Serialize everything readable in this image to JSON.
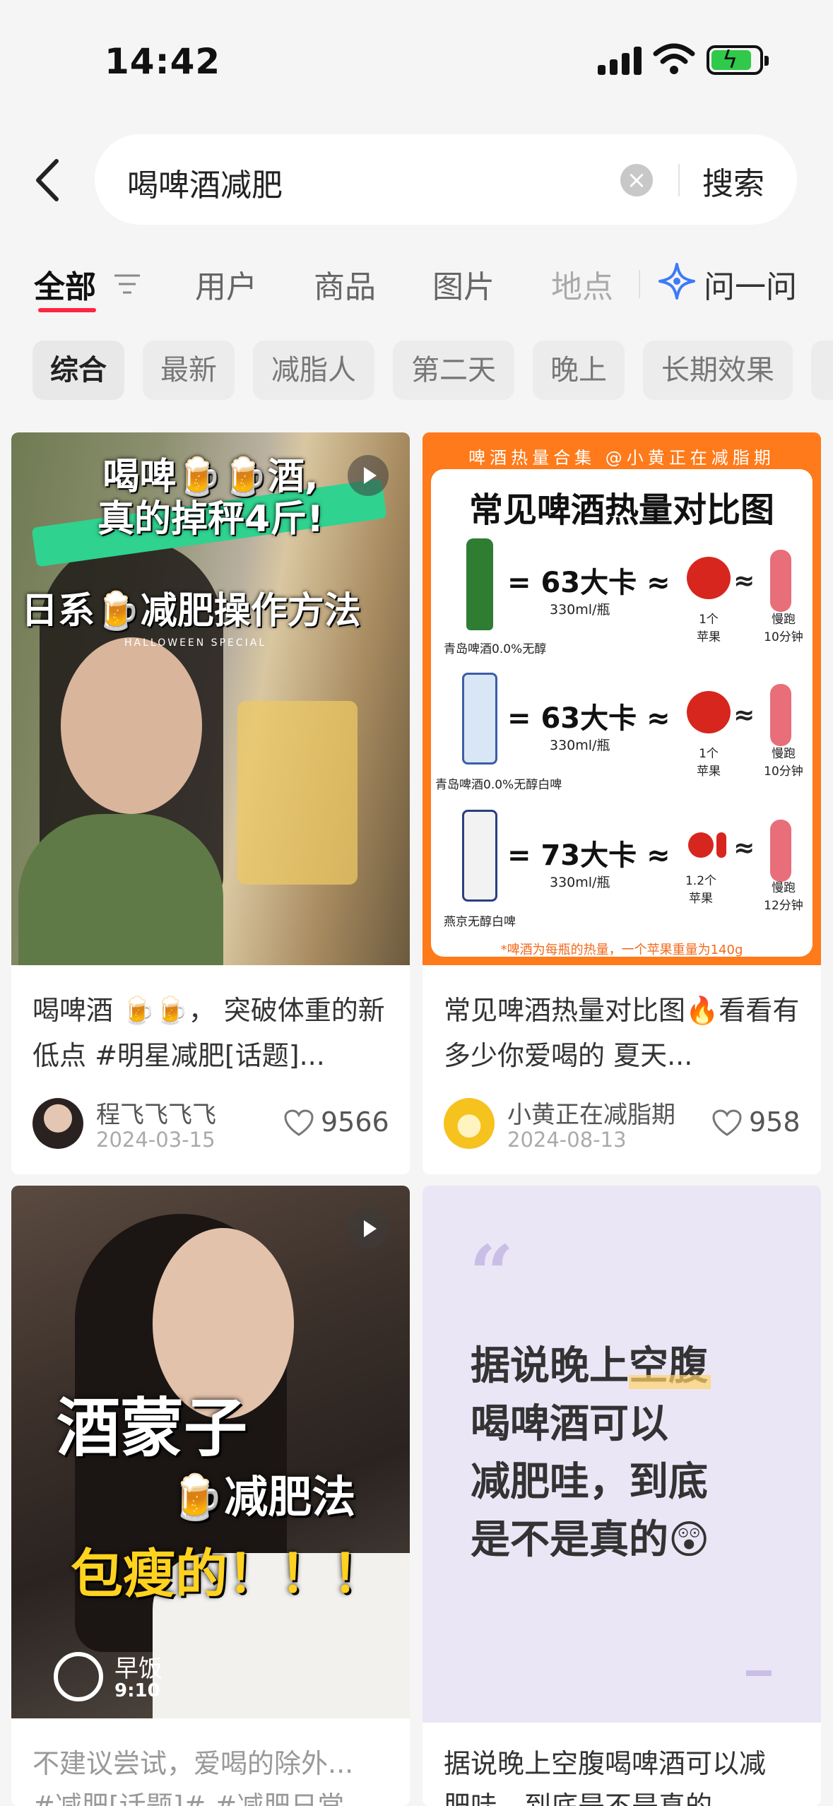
{
  "status": {
    "time": "14:42"
  },
  "search": {
    "query": "喝啤酒减肥",
    "button": "搜索"
  },
  "tabs": {
    "items": [
      "全部",
      "用户",
      "商品",
      "图片",
      "地点"
    ],
    "ask": "问一问"
  },
  "chips": [
    "综合",
    "最新",
    "减脂人",
    "第二天",
    "晚上",
    "长期效果"
  ],
  "cards": [
    {
      "cover_title_1": "喝啤🍺🍺酒,",
      "cover_title_2": "真的掉秤4斤!",
      "cover_title_3": "日系🍺减肥操作方法",
      "cover_small": "HALLOWEEN SPECIAL",
      "caption": "喝啤酒 🍺🍺， 突破体重的新低点 #明星减肥[话题]...",
      "user": "程飞飞飞飞",
      "date": "2024-03-15",
      "likes": "9566"
    },
    {
      "info_header": "啤酒热量合集 @小黄正在减脂期",
      "info_title": "常见啤酒热量对比图",
      "rows": [
        {
          "eq": "= 63大卡 ≈",
          "vol": "330ml/瓶",
          "name": "青岛啤酒0.0%无醇",
          "apple": "1个\n苹果",
          "run": "慢跑\n10分钟"
        },
        {
          "eq": "= 63大卡 ≈",
          "vol": "330ml/瓶",
          "name": "青岛啤酒0.0%无醇白啤",
          "apple": "1个\n苹果",
          "run": "慢跑\n10分钟"
        },
        {
          "eq": "= 73大卡 ≈",
          "vol": "330ml/瓶",
          "name": "燕京无醇白啤",
          "apple": "1.2个\n苹果",
          "run": "慢跑\n12分钟"
        }
      ],
      "info_note": "*啤酒为每瓶的热量，一个苹果重量为140g",
      "caption": "常见啤酒热量对比图🔥看看有多少你爱喝的 夏天...",
      "user": "小黄正在减脂期",
      "date": "2024-08-13",
      "likes": "958"
    },
    {
      "cover_title_1": "酒蒙子",
      "cover_title_2": "🍺减肥法",
      "cover_title_3": "包瘦的！！！",
      "time_label": "早饭",
      "time_value": "9:10",
      "caption_1": "不建议尝试，爱喝的除外...",
      "caption_2": "#减肥[话题]# #减肥日常..."
    },
    {
      "quote_lines": [
        "据说晚上空腹",
        "喝啤酒可以",
        "减肥哇，到底",
        "是不是真的😲"
      ],
      "quote_highlight": "空腹",
      "caption_1": "据说晚上空腹喝啤酒可以减",
      "caption_2": "肥哇，到底是不是真的"
    }
  ]
}
